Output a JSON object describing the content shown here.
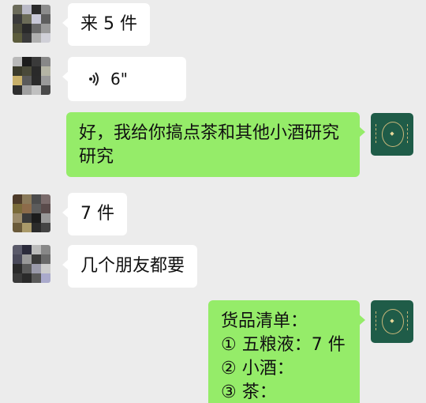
{
  "messages": [
    {
      "side": "left",
      "type": "text",
      "text": "来 5 件"
    },
    {
      "side": "left",
      "type": "voice",
      "duration": "6\""
    },
    {
      "side": "right",
      "type": "text",
      "lines": [
        "好，我给你搞点茶和其他小酒研究",
        "研究"
      ]
    },
    {
      "side": "left",
      "type": "text",
      "text": "7 件"
    },
    {
      "side": "left",
      "type": "text",
      "text": "几个朋友都要"
    },
    {
      "side": "right",
      "type": "text",
      "lines": [
        "货品清单：",
        "① 五粮液：7 件",
        "② 小酒：",
        "③ 茶："
      ]
    }
  ],
  "colors": {
    "background": "#ececec",
    "left_bubble": "#ffffff",
    "right_bubble": "#95ec69",
    "brand_avatar": "#1f5c48",
    "brand_gold": "#c8b77a"
  },
  "icons": {
    "voice": "voice-wave-icon",
    "self_avatar": "brand-logo-avatar",
    "contact_avatar": "pixelated-avatar"
  }
}
